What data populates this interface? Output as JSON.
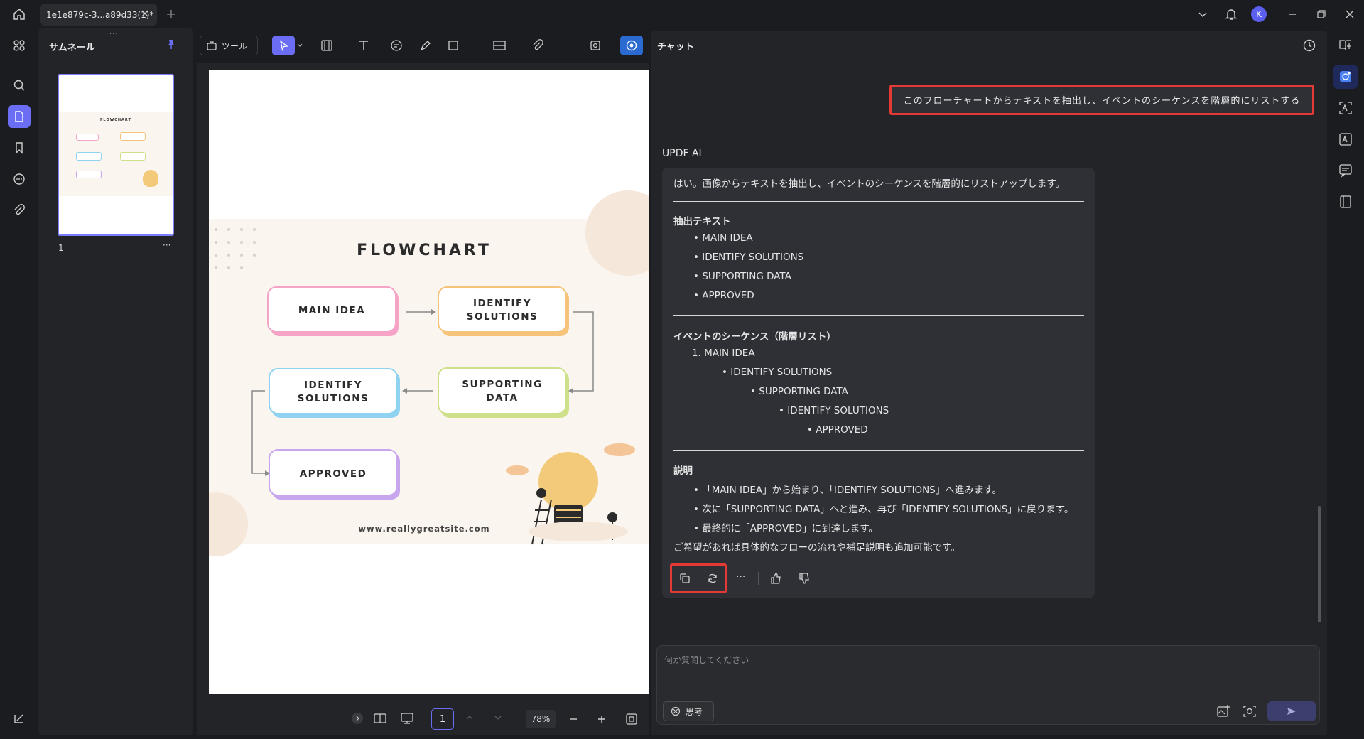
{
  "window": {
    "tab_title": "1e1e879c-3...a89d33(1)*",
    "avatar_initial": "K"
  },
  "thumbnail_panel": {
    "title": "サムネール",
    "page_number": "1",
    "more": "···"
  },
  "toolbar": {
    "tools_label": "ツール"
  },
  "document": {
    "flowchart_title": "FLOWCHART",
    "nodes": {
      "main_idea": "MAIN IDEA",
      "identify_1_l1": "IDENTIFY",
      "identify_1_l2": "SOLUTIONS",
      "supporting_l1": "SUPPORTING",
      "supporting_l2": "DATA",
      "identify_2_l1": "IDENTIFY",
      "identify_2_l2": "SOLUTIONS",
      "approved": "APPROVED"
    },
    "website": "www.reallygreatsite.com"
  },
  "bottombar": {
    "page_input": "1",
    "zoom": "78%"
  },
  "chat": {
    "title": "チャット",
    "user_message": "このフローチャートからテキストを抽出し、イベントのシーケンスを階層的にリストする",
    "ai_name": "UPDF AI",
    "reply": {
      "intro": "はい。画像からテキストを抽出し、イベントのシーケンスを階層的にリストアップします。",
      "extract_heading": "抽出テキスト",
      "extract_items": [
        "• MAIN IDEA",
        "• IDENTIFY SOLUTIONS",
        "• SUPPORTING DATA",
        "• APPROVED"
      ],
      "sequence_heading": "イベントのシーケンス（階層リスト）",
      "seq_1": "1. MAIN IDEA",
      "seq_2": "• IDENTIFY SOLUTIONS",
      "seq_3": "• SUPPORTING DATA",
      "seq_4": "• IDENTIFY SOLUTIONS",
      "seq_5": "• APPROVED",
      "explain_heading": "説明",
      "explain_items": [
        "• 「MAIN IDEA」から始まり、「IDENTIFY SOLUTIONS」へ進みます。",
        "• 次に「SUPPORTING DATA」へと進み、再び「IDENTIFY SOLUTIONS」に戻ります。",
        "• 最終的に「APPROVED」に到達します。"
      ],
      "closing": "ご希望があれば具体的なフローの流れや補足説明も追加可能です。"
    },
    "input_placeholder": "何か質問してください",
    "think_label": "思考"
  },
  "colors": {
    "accent": "#6b6ef5",
    "highlight_red": "#e53935"
  }
}
